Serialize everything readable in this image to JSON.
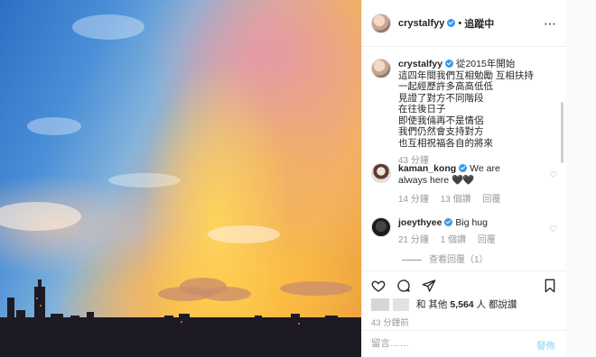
{
  "colors": {
    "accent": "#3897f0",
    "post_disabled": "#b2dffc",
    "muted": "#999999",
    "text": "#262626"
  },
  "photo": {
    "description_icon": "sunset-photo"
  },
  "header": {
    "username": "crystalfyy",
    "separator": "•",
    "follow_state": "追蹤中",
    "more_icon": "⋯"
  },
  "caption": {
    "username": "crystalfyy",
    "lines": [
      "從2015年開始",
      "這四年間我們互相勉勵 互相扶持",
      "一起經歷許多高高低低",
      "見證了對方不同階段",
      "在往後日子",
      "即使我倆再不是情侶",
      "我們仍然會支持對方",
      "也互相祝福各自的將來"
    ],
    "time": "43 分鐘"
  },
  "comments": [
    {
      "username": "kaman_kong",
      "text_line1": "We are",
      "text_line2": "always here",
      "emoji": "🖤🖤",
      "time": "14 分鐘",
      "likes": "13 個讚",
      "reply": "回覆"
    },
    {
      "username": "joeythyee",
      "text_line1": "Big hug",
      "time": "21 分鐘",
      "likes": "1 個讚",
      "reply": "回覆"
    }
  ],
  "view_replies": "查看回覆（1）",
  "likes": {
    "suffix_prefix": "和 其他",
    "count": "5,564",
    "suffix": "人 都說讚"
  },
  "post_time": "43 分鐘前",
  "add_comment": {
    "placeholder": "留言……",
    "post_label": "發佈"
  }
}
